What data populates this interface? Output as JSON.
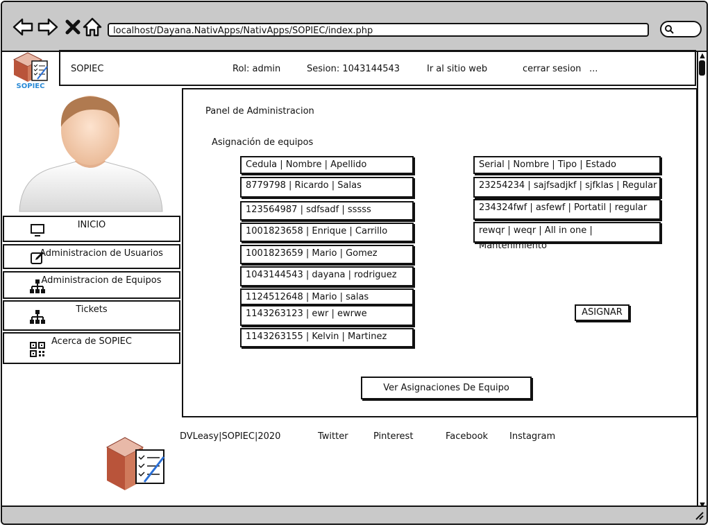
{
  "browser": {
    "url": "localhost/Dayana.NativApps/NativApps/SOPIEC/index.php"
  },
  "header": {
    "app_name": "SOPIEC",
    "role": "Rol: admin",
    "session": "Sesion: 1043144543",
    "site_link": "Ir al sitio web",
    "logout": "cerrar sesion",
    "more": "..."
  },
  "logo": {
    "text": "SOPIEC"
  },
  "menu": {
    "items": [
      {
        "label": "INICIO",
        "icon": "monitor-icon"
      },
      {
        "label": "Administracion de Usuarios",
        "icon": "edit-icon"
      },
      {
        "label": "Administracion de Equipos",
        "icon": "sitemap-icon"
      },
      {
        "label": "Tickets",
        "icon": "sitemap-icon"
      },
      {
        "label": "Acerca de SOPIEC",
        "icon": "qr-code-icon"
      }
    ]
  },
  "main": {
    "title": "Panel de Administracion",
    "subtitle": "Asignación de equipos",
    "users_header": "Cedula | Nombre | Apellido",
    "users": [
      "8779798 | Ricardo | Salas",
      "123564987 | sdfsadf | sssss",
      "1001823658 | Enrique | Carrillo",
      "1001823659 | Mario | Gomez",
      "1043144543 | dayana | rodriguez",
      "1124512648 | Mario | salas",
      "1143263123 | ewr | ewrwe",
      "1143263155 | Kelvin | Martinez"
    ],
    "equipment_header": "Serial | Nombre | Tipo | Estado",
    "equipment": [
      "23254234 | sajfsadjkf | sjfklas | Regular",
      "234324fwf | asfewf | Portatil | regular",
      "rewqr | weqr | All in one | Mantenimiento"
    ],
    "assign_button": "ASIGNAR",
    "view_button": "Ver Asignaciones De Equipo"
  },
  "footer": {
    "copyright": "DVLeasy|SOPIEC|2020",
    "links": [
      "Twitter",
      "Pinterest",
      "Facebook",
      "Instagram"
    ]
  }
}
